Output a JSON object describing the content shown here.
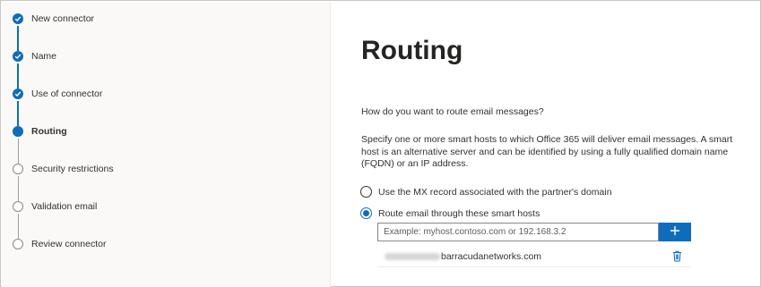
{
  "steps": [
    {
      "label": "New connector",
      "status": "done"
    },
    {
      "label": "Name",
      "status": "done"
    },
    {
      "label": "Use of connector",
      "status": "done"
    },
    {
      "label": "Routing",
      "status": "current"
    },
    {
      "label": "Security restrictions",
      "status": "todo"
    },
    {
      "label": "Validation email",
      "status": "todo"
    },
    {
      "label": "Review connector",
      "status": "todo"
    }
  ],
  "main": {
    "title": "Routing",
    "question": "How do you want to route email messages?",
    "description": "Specify one or more smart hosts to which Office 365 will deliver email messages. A smart host is an alternative server and can be identified by using a fully qualified domain name (FQDN) or an IP address.",
    "options": [
      {
        "label": "Use the MX record associated with the partner's domain",
        "checked": false
      },
      {
        "label": "Route email through these smart hosts",
        "checked": true
      }
    ],
    "smart_host_input": {
      "value": "",
      "placeholder": "Example: myhost.contoso.com or 192.168.3.2"
    },
    "add_button_icon": "plus-icon",
    "smart_hosts": [
      {
        "value": "barracudanetworks.com",
        "delete_icon": "trash-icon"
      }
    ]
  },
  "colors": {
    "accent": "#0f6cbd",
    "border": "#c8c6c4",
    "text": "#323130",
    "left_panel_bg": "#faf9f8"
  }
}
